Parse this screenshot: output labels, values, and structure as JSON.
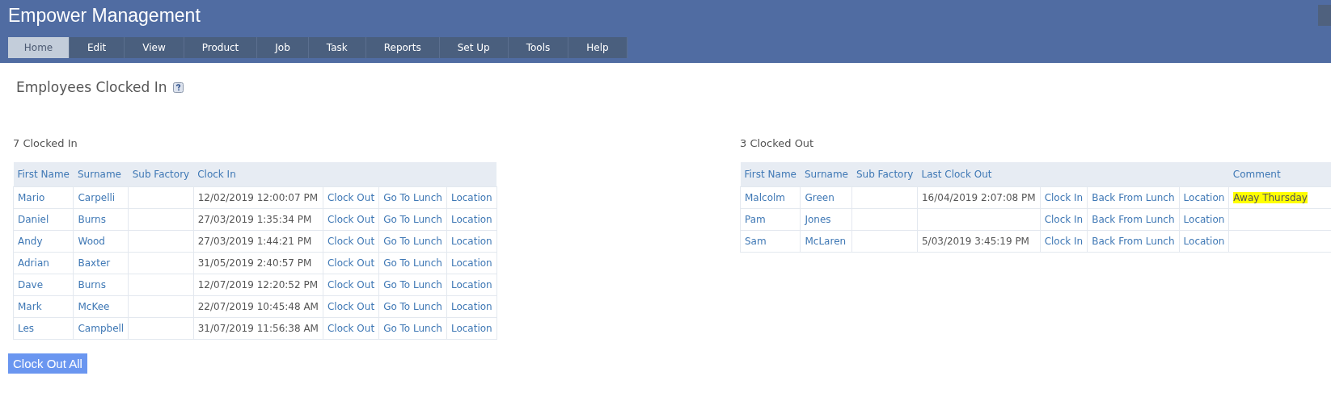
{
  "app": {
    "title": "Empower Management"
  },
  "menu": [
    {
      "label": "Home",
      "selected": true
    },
    {
      "label": "Edit",
      "selected": false
    },
    {
      "label": "View",
      "selected": false
    },
    {
      "label": "Product",
      "selected": false
    },
    {
      "label": "Job",
      "selected": false
    },
    {
      "label": "Task",
      "selected": false
    },
    {
      "label": "Reports",
      "selected": false
    },
    {
      "label": "Set Up",
      "selected": false
    },
    {
      "label": "Tools",
      "selected": false
    },
    {
      "label": "Help",
      "selected": false
    }
  ],
  "page": {
    "title": "Employees Clocked In"
  },
  "clocked_in": {
    "heading": "7 Clocked In",
    "columns": [
      "First Name",
      "Surname",
      "Sub Factory",
      "Clock In"
    ],
    "rows": [
      {
        "first_name": "Mario",
        "surname": "Carpelli",
        "time": "12/02/2019 12:00:07 PM",
        "actions": [
          "Clock Out",
          "Go To Lunch",
          "Location"
        ]
      },
      {
        "first_name": "Daniel",
        "surname": "Burns",
        "time": "27/03/2019 1:35:34 PM",
        "actions": [
          "Clock Out",
          "Go To Lunch",
          "Location"
        ]
      },
      {
        "first_name": "Andy",
        "surname": "Wood",
        "time": "27/03/2019 1:44:21 PM",
        "actions": [
          "Clock Out",
          "Go To Lunch",
          "Location"
        ]
      },
      {
        "first_name": "Adrian",
        "surname": "Baxter",
        "time": "31/05/2019 2:40:57 PM",
        "actions": [
          "Clock Out",
          "Go To Lunch",
          "Location"
        ]
      },
      {
        "first_name": "Dave",
        "surname": "Burns",
        "time": "12/07/2019 12:20:52 PM",
        "actions": [
          "Clock Out",
          "Go To Lunch",
          "Location"
        ]
      },
      {
        "first_name": "Mark",
        "surname": "McKee",
        "time": "22/07/2019 10:45:48 AM",
        "actions": [
          "Clock Out",
          "Go To Lunch",
          "Location"
        ]
      },
      {
        "first_name": "Les",
        "surname": "Campbell",
        "time": "31/07/2019 11:56:38 AM",
        "actions": [
          "Clock Out",
          "Go To Lunch",
          "Location"
        ]
      }
    ],
    "button": "Clock Out All"
  },
  "clocked_out": {
    "heading": "3 Clocked Out",
    "columns": [
      "First Name",
      "Surname",
      "Sub Factory",
      "Last Clock Out",
      "Comment"
    ],
    "rows": [
      {
        "first_name": "Malcolm",
        "surname": "Green",
        "time": "16/04/2019 2:07:08 PM",
        "actions": [
          "Clock In",
          "Back From Lunch",
          "Location"
        ],
        "comment": {
          "text": "Away Thursday",
          "highlighted": true
        }
      },
      {
        "first_name": "Pam",
        "surname": "Jones",
        "actions": [
          "Clock In",
          "Back From Lunch",
          "Location"
        ]
      },
      {
        "first_name": "Sam",
        "surname": "McLaren",
        "time": "5/03/2019 3:45:19 PM",
        "actions": [
          "Clock In",
          "Back From Lunch",
          "Location"
        ]
      }
    ]
  }
}
